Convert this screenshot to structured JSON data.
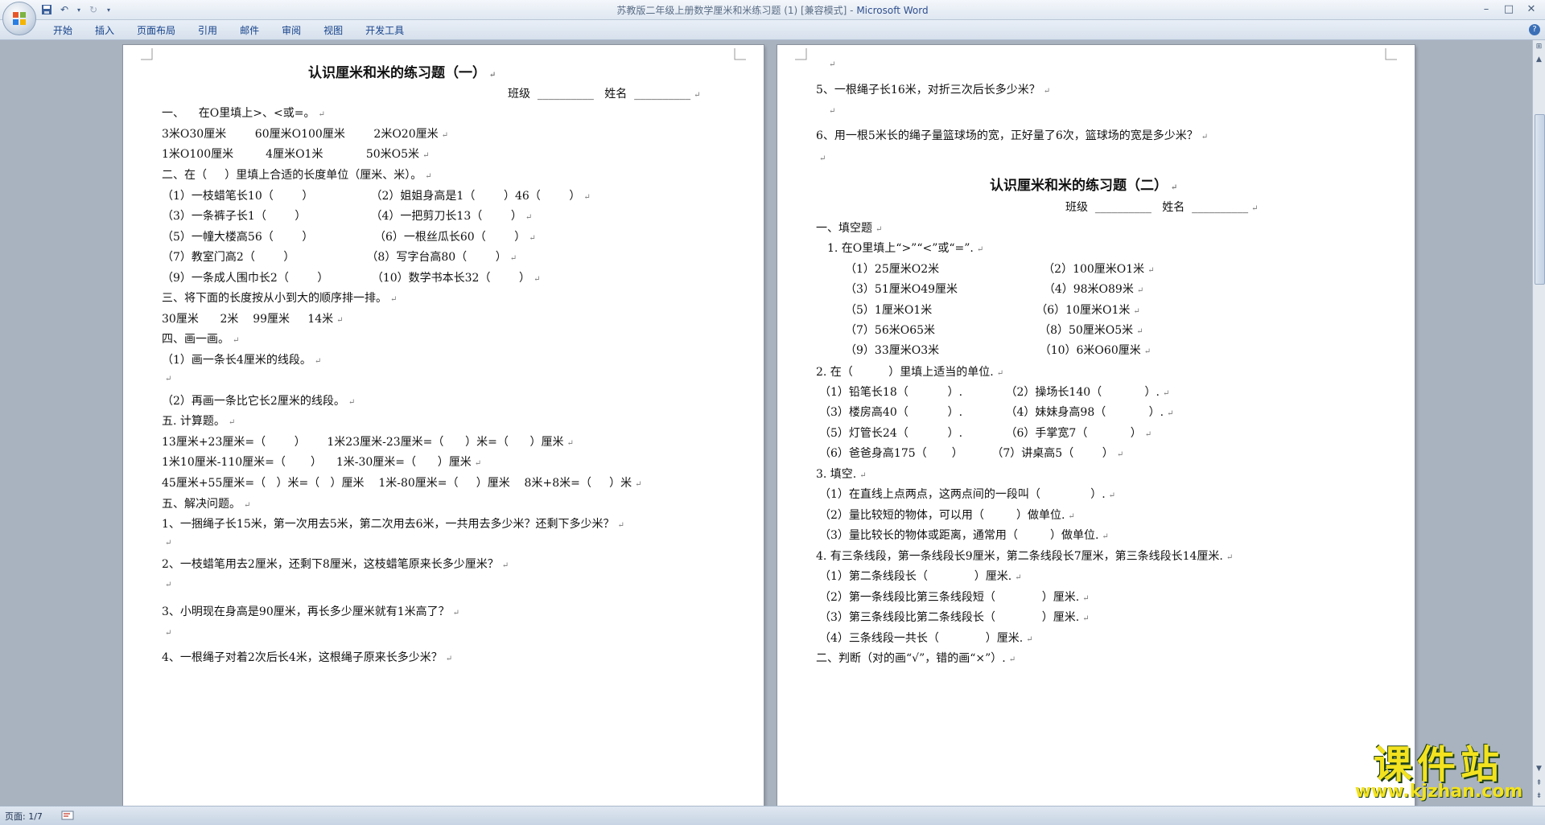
{
  "window": {
    "title_doc": "苏教版二年级上册数学厘米和米练习题 (1) [兼容模式] - ",
    "title_app": "Microsoft Word"
  },
  "ribbon": {
    "tabs": [
      "开始",
      "插入",
      "页面布局",
      "引用",
      "邮件",
      "审阅",
      "视图",
      "开发工具"
    ]
  },
  "status": {
    "page": "页面: 1/7"
  },
  "watermark": {
    "big": "课件站",
    "small": "www.kjzhan.com"
  },
  "page1": {
    "lines": [
      "认识厘米和米的练习题（一）",
      "班级  __________   姓名  __________",
      "一、    在O里填上>、<或=。",
      "3米O30厘米        60厘米O100厘米        2米O20厘米",
      "1米O100厘米         4厘米O1米            50米O5米",
      "二、在（     ）里填上合适的长度单位（厘米、米）。",
      "（1）一枝蜡笔长10（        ）                （2）姐姐身高是1（        ）46（        ）",
      "（3）一条裤子长1（        ）                  （4）一把剪刀长13（        ）",
      "（5）一幢大楼高56（        ）                 （6）一根丝瓜长60（        ）",
      "（7）教室门高2（        ）                    （8）写字台高80（        ）",
      "（9）一条成人围巾长2（        ）            （10）数学书本长32（        ）",
      "三、将下面的长度按从小到大的顺序排一排。",
      "30厘米      2米    99厘米     14米",
      "四、画一画。",
      "（1）画一条长4厘米的线段。",
      "",
      "（2）再画一条比它长2厘米的线段。",
      "五. 计算题。",
      "13厘米+23厘米=（        ）      1米23厘米-23厘米=（      ）米=（      ）厘米",
      "1米10厘米-110厘米=（       ）    1米-30厘米=（      ）厘米",
      "45厘米+55厘米=（   ）米=（   ）厘米    1米-80厘米=（     ）厘米    8米+8米=（     ）米",
      "五、解决问题。",
      "1、一捆绳子长15米，第一次用去5米，第二次用去6米，一共用去多少米？还剩下多少米？",
      "",
      "2、一枝蜡笔用去2厘米，还剩下8厘米，这枝蜡笔原来长多少厘米？",
      "",
      "3、小明现在身高是90厘米，再长多少厘米就有1米高了？",
      "",
      "4、一根绳子对着2次后长4米，这根绳子原来长多少米？"
    ]
  },
  "page2": {
    "lines": [
      "",
      "5、一根绳子长16米，对折三次后长多少米？",
      "",
      "6、用一根5米长的绳子量篮球场的宽，正好量了6次，篮球场的宽是多少米？",
      "",
      "认识厘米和米的练习题（二）",
      "班级  __________   姓名  __________",
      "一、填空题",
      "1. 在O里填上“>”“<”或“=”.",
      "（1）25厘米O2米                             （2）100厘米O1米",
      "（3）51厘米O49厘米                        （4）98米O89米",
      "（5）1厘米O1米                             （6）10厘米O1米",
      "（7）56米O65米                             （8）50厘米O5米",
      "（9）33厘米O3米                            （10）6米O60厘米",
      "2. 在（          ）里填上适当的单位.",
      "（1）铅笔长18（           ）.            （2）操场长140（            ）.",
      "（3）楼房高40（           ）.            （4）妹妹身高98（            ）.",
      "（5）灯管长24（           ）.            （6）手掌宽7（            ）",
      "（6）爸爸身高175（       ）        （7）讲桌高5（        ）",
      "3. 填空.",
      "（1）在直线上点两点，这两点间的一段叫（              ）.",
      "（2）量比较短的物体，可以用（         ）做单位.",
      "（3）量比较长的物体或距离，通常用（         ）做单位.",
      "4. 有三条线段，第一条线段长9厘米，第二条线段长7厘米，第三条线段长14厘米.",
      "（1）第二条线段长（             ）厘米.",
      "（2）第一条线段比第三条线段短（             ）厘米.",
      "（3）第三条线段比第二条线段长（             ）厘米.",
      "（4）三条线段一共长（             ）厘米.",
      "二、判断（对的画“√”，错的画“×”）."
    ]
  }
}
